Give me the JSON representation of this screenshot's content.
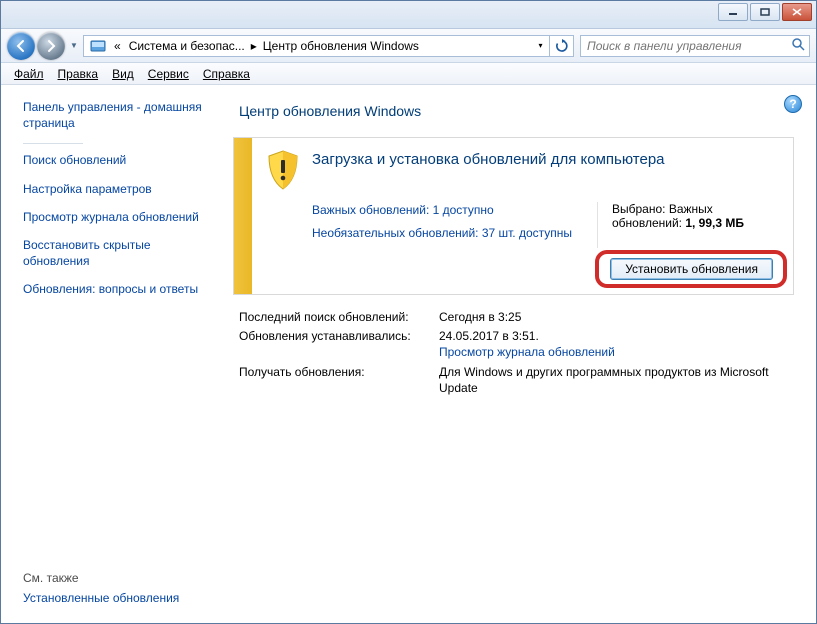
{
  "titlebar": {},
  "nav": {
    "breadcrumb_prefix": "«",
    "crumb1": "Система и безопас...",
    "crumb2": "Центр обновления Windows",
    "search_placeholder": "Поиск в панели управления"
  },
  "menu": {
    "file": "Файл",
    "edit": "Правка",
    "view": "Вид",
    "tools": "Сервис",
    "help": "Справка"
  },
  "sidebar": {
    "home": "Панель управления - домашняя страница",
    "links": [
      "Поиск обновлений",
      "Настройка параметров",
      "Просмотр журнала обновлений",
      "Восстановить скрытые обновления",
      "Обновления: вопросы и ответы"
    ],
    "see_also": "См. также",
    "installed": "Установленные обновления"
  },
  "main": {
    "title": "Центр обновления Windows",
    "panel": {
      "heading": "Загрузка и установка обновлений для компьютера",
      "important_link": "Важных обновлений: 1 доступно",
      "optional_link": "Необязательных обновлений: 37 шт. доступны",
      "selected_label": "Выбрано: Важных обновлений: 1, 99,3 МБ",
      "install_button": "Установить обновления"
    },
    "info": {
      "last_check_label": "Последний поиск обновлений:",
      "last_check_value": "Сегодня в 3:25",
      "installed_label": "Обновления устанавливались:",
      "installed_value": "24.05.2017 в 3:51.",
      "installed_link": "Просмотр журнала обновлений",
      "receive_label": "Получать обновления:",
      "receive_value": "Для Windows и других программных продуктов из Microsoft Update"
    }
  }
}
